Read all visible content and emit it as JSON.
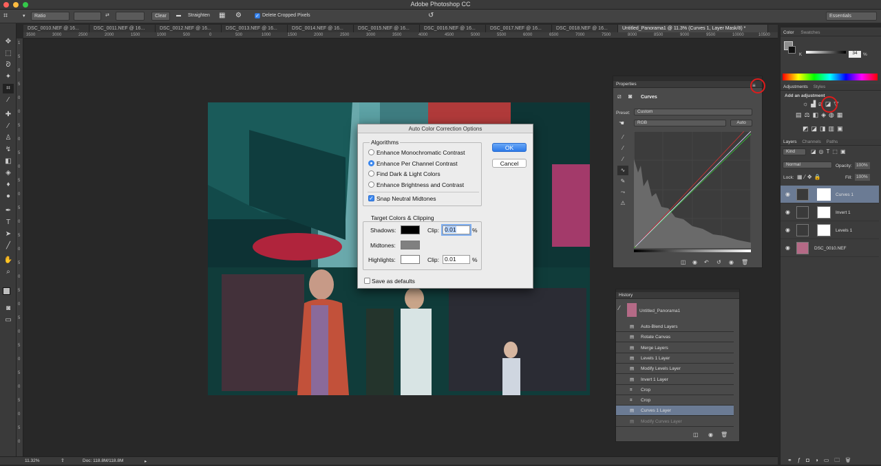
{
  "app": {
    "title": "Adobe Photoshop CC"
  },
  "options_bar": {
    "ratio": "Ratio",
    "clear": "Clear",
    "straighten": "Straighten",
    "delete_cropped": "Delete Cropped Pixels",
    "workspace": "Essentials"
  },
  "doc_tabs": [
    "DSC_0010.NEF @ 16...",
    "DSC_0011.NEF @ 16...",
    "DSC_0012.NEF @ 16...",
    "DSC_0013.NEF @ 16...",
    "DSC_0014.NEF @ 16...",
    "DSC_0015.NEF @ 16...",
    "DSC_0016.NEF @ 16...",
    "DSC_0017.NEF @ 16...",
    "DSC_0018.NEF @ 16...",
    "Untitled_Panorama1 @ 11.3% (Curves 1, Layer Mask/8) *"
  ],
  "ruler_h": [
    "3500",
    "3000",
    "2500",
    "2000",
    "1500",
    "1000",
    "500",
    "0",
    "500",
    "1000",
    "1500",
    "2000",
    "2500",
    "3000",
    "3500",
    "4000",
    "4500",
    "5000",
    "5500",
    "6000",
    "6500",
    "7000",
    "7500",
    "8000",
    "8500",
    "9000",
    "9500",
    "10000",
    "10500"
  ],
  "ruler_v": [
    "1",
    "5",
    "0",
    "5",
    "0",
    "0",
    "5",
    "0",
    "5",
    "0",
    "5",
    "0",
    "5",
    "0",
    "5",
    "0",
    "5",
    "0",
    "5",
    "0",
    "5",
    "0",
    "5",
    "0",
    "5",
    "0",
    "5",
    "0",
    "5",
    "0"
  ],
  "status": {
    "zoom": "11.32%",
    "doc": "Doc: 118.8M/118.8M"
  },
  "dialog": {
    "title": "Auto Color Correction Options",
    "algorithms_label": "Algorithms",
    "options": [
      {
        "label": "Enhance Monochromatic Contrast",
        "selected": false
      },
      {
        "label": "Enhance Per Channel Contrast",
        "selected": true
      },
      {
        "label": "Find Dark & Light Colors",
        "selected": false
      },
      {
        "label": "Enhance Brightness and Contrast",
        "selected": false
      }
    ],
    "snap_label": "Snap Neutral Midtones",
    "snap_checked": true,
    "target_label": "Target Colors & Clipping",
    "shadows_label": "Shadows:",
    "midtones_label": "Midtones:",
    "highlights_label": "Highlights:",
    "clip_label": "Clip:",
    "shadow_clip": "0.01",
    "highlight_clip": "0.01",
    "percent": "%",
    "save_defaults": "Save as defaults",
    "ok": "OK",
    "cancel": "Cancel",
    "colors": {
      "shadows": "#000000",
      "midtones": "#808080",
      "highlights": "#ffffff"
    }
  },
  "properties": {
    "tab": "Properties",
    "title": "Curves",
    "preset_label": "Preset:",
    "preset_value": "Custom",
    "channel": "RGB",
    "auto": "Auto"
  },
  "history": {
    "tab": "History",
    "snapshot": "Untitled_Panorama1",
    "items": [
      {
        "label": "Auto-Blend Layers",
        "state": "normal"
      },
      {
        "label": "Rotate Canvas",
        "state": "normal"
      },
      {
        "label": "Merge Layers",
        "state": "normal"
      },
      {
        "label": "Levels 1 Layer",
        "state": "normal"
      },
      {
        "label": "Modify Levels Layer",
        "state": "normal"
      },
      {
        "label": "Invert 1 Layer",
        "state": "normal"
      },
      {
        "label": "Crop",
        "state": "normal"
      },
      {
        "label": "Crop",
        "state": "normal"
      },
      {
        "label": "Curves 1 Layer",
        "state": "selected"
      },
      {
        "label": "Modify Curves Layer",
        "state": "dim"
      }
    ]
  },
  "color_panel": {
    "tab": "Color",
    "tab2": "Swatches",
    "k_label": "K",
    "value": "34",
    "unit": "%"
  },
  "adjustments": {
    "tab": "Adjustments",
    "tab2": "Styles",
    "heading": "Add an adjustment"
  },
  "layers": {
    "tab": "Layers",
    "tab2": "Channels",
    "tab3": "Paths",
    "kind": "Kind",
    "blend": "Normal",
    "opacity_label": "Opacity:",
    "opacity": "100%",
    "lock_label": "Lock:",
    "fill_label": "Fill:",
    "fill": "100%",
    "items": [
      {
        "name": "Curves 1",
        "selected": true
      },
      {
        "name": "Invert 1",
        "selected": false
      },
      {
        "name": "Levels 1",
        "selected": false
      },
      {
        "name": "DSC_0010.NEF",
        "selected": false
      }
    ]
  }
}
